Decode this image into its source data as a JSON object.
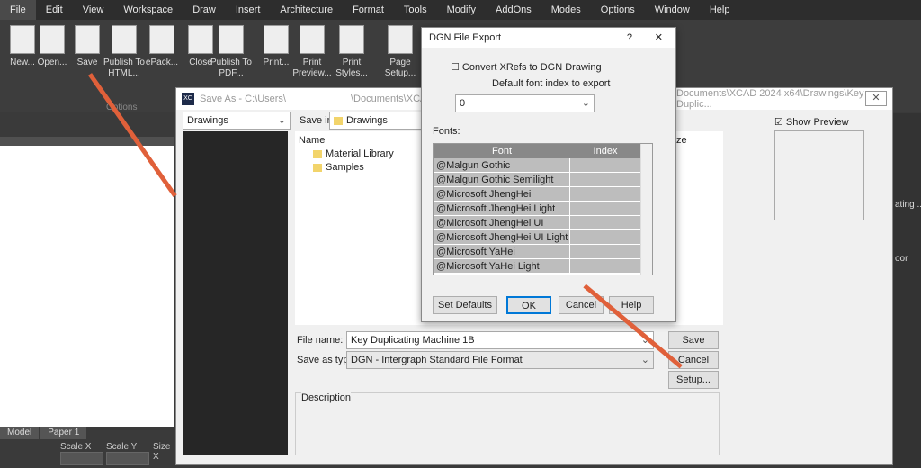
{
  "menu": [
    "File",
    "Edit",
    "View",
    "Workspace",
    "Draw",
    "Insert",
    "Architecture",
    "Format",
    "Tools",
    "Modify",
    "AddOns",
    "Modes",
    "Options",
    "Window",
    "Help"
  ],
  "ribbon": {
    "buttons": [
      "New...",
      "Open...",
      "Save",
      "Publish To HTML...",
      "ePack...",
      "Close",
      "Publish To PDF...",
      "Print...",
      "Print Preview...",
      "Print Styles...",
      "Page Setup..."
    ],
    "group": "Options"
  },
  "tabs": {
    "model": "Model",
    "paper": "Paper 1"
  },
  "props": {
    "scale_x": "Scale X",
    "scale_y": "Scale Y",
    "size_x": "Size X"
  },
  "right_panel": [
    "ating ...",
    "oor"
  ],
  "save_as": {
    "title": "Save As - C:\\Users\\",
    "title_rest": "\\Documents\\XCAD 2024 x64\\D",
    "title_right": "Documents\\XCAD 2024 x64\\Drawings\\Key Duplic...",
    "places": "Drawings",
    "save_in_label": "Save in:",
    "save_in": "Drawings",
    "col_name": "Name",
    "col_size": "ze",
    "items": [
      "Material Library",
      "Samples"
    ],
    "file_name_label": "File name:",
    "file_name": "Key Duplicating Machine 1B",
    "type_label": "Save as type:",
    "type": "DGN - Intergraph Standard File Format",
    "save": "Save",
    "cancel": "Cancel",
    "setup": "Setup...",
    "description": "Description",
    "show_preview": "Show Preview"
  },
  "dgn": {
    "title": "DGN File Export",
    "help": "?",
    "close": "✕",
    "convert_xrefs": "Convert XRefs to DGN Drawing",
    "default_font_label": "Default font index to export",
    "default_font": "0",
    "fonts_label": "Fonts:",
    "col_font": "Font",
    "col_index": "Index",
    "fonts": [
      "@Malgun Gothic",
      "@Malgun Gothic Semilight",
      "@Microsoft JhengHei",
      "@Microsoft JhengHei Light",
      "@Microsoft JhengHei UI",
      "@Microsoft JhengHei UI Light",
      "@Microsoft YaHei",
      "@Microsoft YaHei Light"
    ],
    "set_defaults": "Set Defaults",
    "ok": "OK",
    "cancel": "Cancel",
    "help_btn": "Help"
  }
}
